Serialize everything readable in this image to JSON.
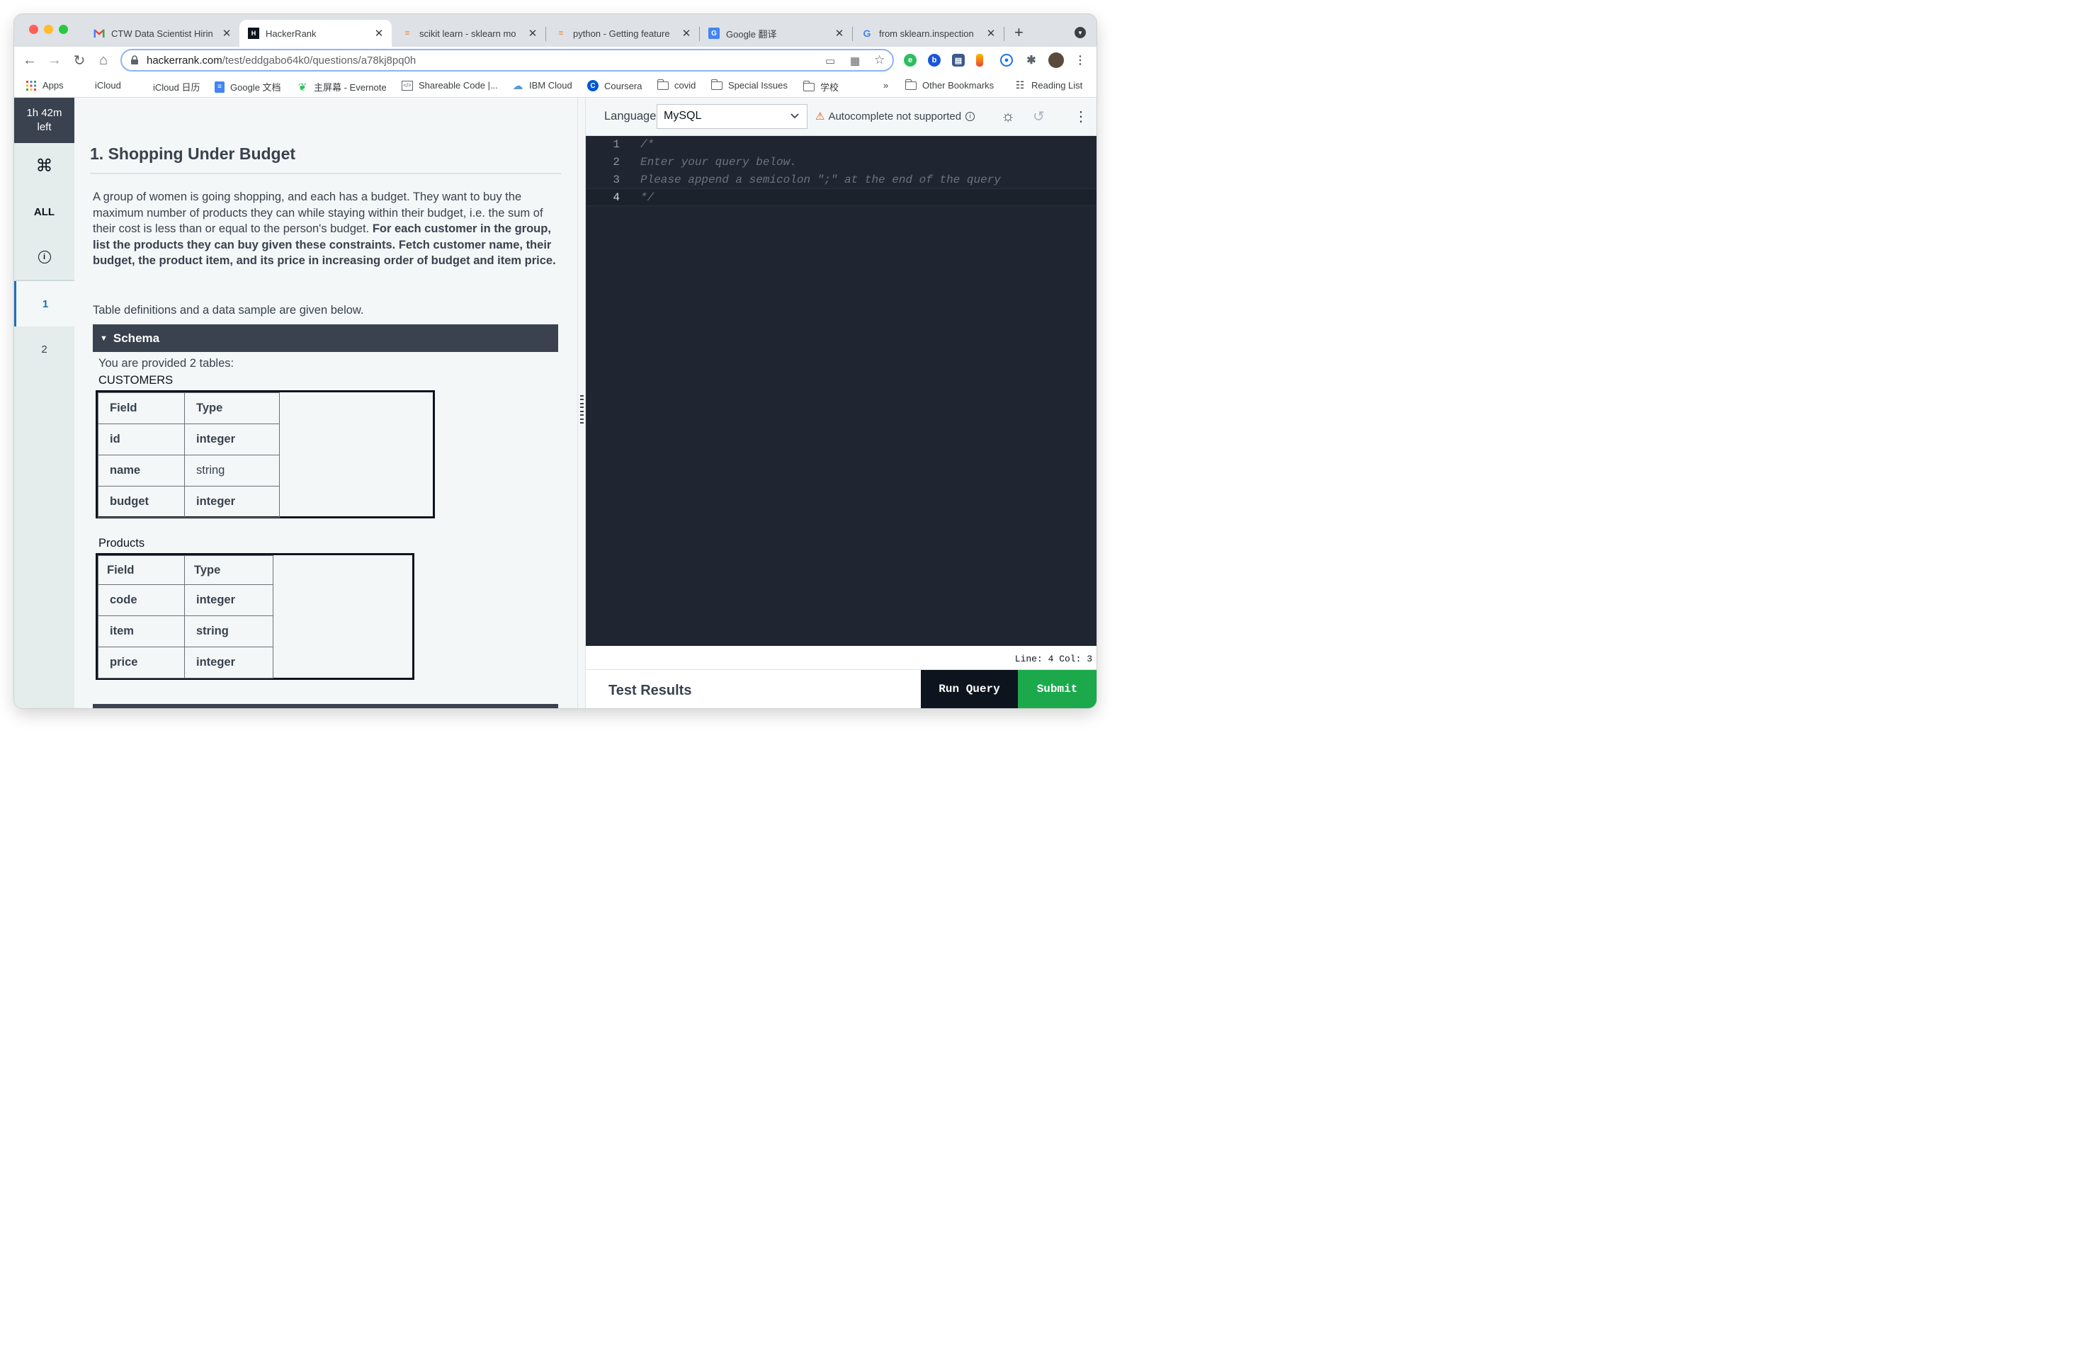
{
  "browser": {
    "tabs": [
      {
        "label": "CTW Data Scientist Hirin",
        "icon": "gmail-icon",
        "close": "✕"
      },
      {
        "label": "HackerRank",
        "icon": "hackerrank-icon",
        "close": "✕"
      },
      {
        "label": "scikit learn - sklearn mo",
        "icon": "stackoverflow-icon",
        "close": "✕"
      },
      {
        "label": "python - Getting feature",
        "icon": "stackoverflow-icon",
        "close": "✕"
      },
      {
        "label": "Google 翻译",
        "icon": "google-translate-icon",
        "close": "✕"
      },
      {
        "label": "from sklearn.inspection",
        "icon": "google-icon",
        "close": "✕"
      }
    ],
    "new_tab": "+",
    "url_host": "hackerrank.com",
    "url_path": "/test/eddgabo64k0/questions/a78kj8pq0h",
    "bookmarks": [
      {
        "label": "Apps",
        "icon": "apps-grid-icon"
      },
      {
        "label": "iCloud",
        "icon": "apple-icon"
      },
      {
        "label": "iCloud 日历",
        "icon": "apple-icon"
      },
      {
        "label": "Google 文档",
        "icon": "google-docs-icon"
      },
      {
        "label": "主屏幕 - Evernote",
        "icon": "evernote-icon"
      },
      {
        "label": "Shareable Code |...",
        "icon": "code-icon"
      },
      {
        "label": "IBM Cloud",
        "icon": "cloud-icon"
      },
      {
        "label": "Coursera",
        "icon": "coursera-icon"
      },
      {
        "label": "covid",
        "icon": "folder-icon"
      },
      {
        "label": "Special Issues",
        "icon": "folder-icon"
      },
      {
        "label": "学校",
        "icon": "folder-icon"
      }
    ],
    "bookmarks_overflow": "»",
    "other_bookmarks": "Other Bookmarks",
    "reading_list": "Reading List"
  },
  "sidebar": {
    "timer_line1": "1h 42m",
    "timer_line2": "left",
    "cmd_glyph": "⌘",
    "all_label": "ALL",
    "info_glyph": "i",
    "questions": [
      "1",
      "2"
    ],
    "selected_question": "1"
  },
  "problem": {
    "title": "1. Shopping Under Budget",
    "description_plain": "A group of women is going shopping, and each has a budget. They want to buy the maximum number of products they can while staying within their budget, i.e. the sum of their cost is less than or equal to the person's budget. ",
    "description_bold": "For each customer in the group, list the products they can buy given these constraints. Fetch customer name, their budget, the product item, and its price in increasing order of budget and item price.",
    "note": "Table definitions and a data sample are given below.",
    "schema_label": "Schema",
    "provided_text": "You are provided 2 tables:",
    "tables": [
      {
        "name": "CUSTOMERS",
        "header": [
          "Field",
          "Type"
        ],
        "rows": [
          [
            "id",
            "integer"
          ],
          [
            "name",
            "string"
          ],
          [
            "budget",
            "integer"
          ]
        ]
      },
      {
        "name": "Products",
        "header": [
          "Field",
          "Type"
        ],
        "rows": [
          [
            "code",
            "integer"
          ],
          [
            "item",
            "string"
          ],
          [
            "price",
            "integer"
          ]
        ]
      }
    ]
  },
  "editor": {
    "language_label": "Language",
    "language_value": "MySQL",
    "autocomplete_note": "Autocomplete not supported",
    "lines": [
      {
        "num": "1",
        "text": "/*"
      },
      {
        "num": "2",
        "text": "Enter your query below."
      },
      {
        "num": "3",
        "text": "Please append a semicolon \";\" at the end of the query"
      },
      {
        "num": "4",
        "text": "*/"
      }
    ],
    "cursor_status": "Line: 4 Col: 3",
    "results_title": "Test Results",
    "run_label": "Run Query",
    "submit_label": "Submit"
  },
  "colors": {
    "accent_green": "#1ba94c",
    "dark_header": "#39424e",
    "editor_bg": "#1f2631"
  }
}
